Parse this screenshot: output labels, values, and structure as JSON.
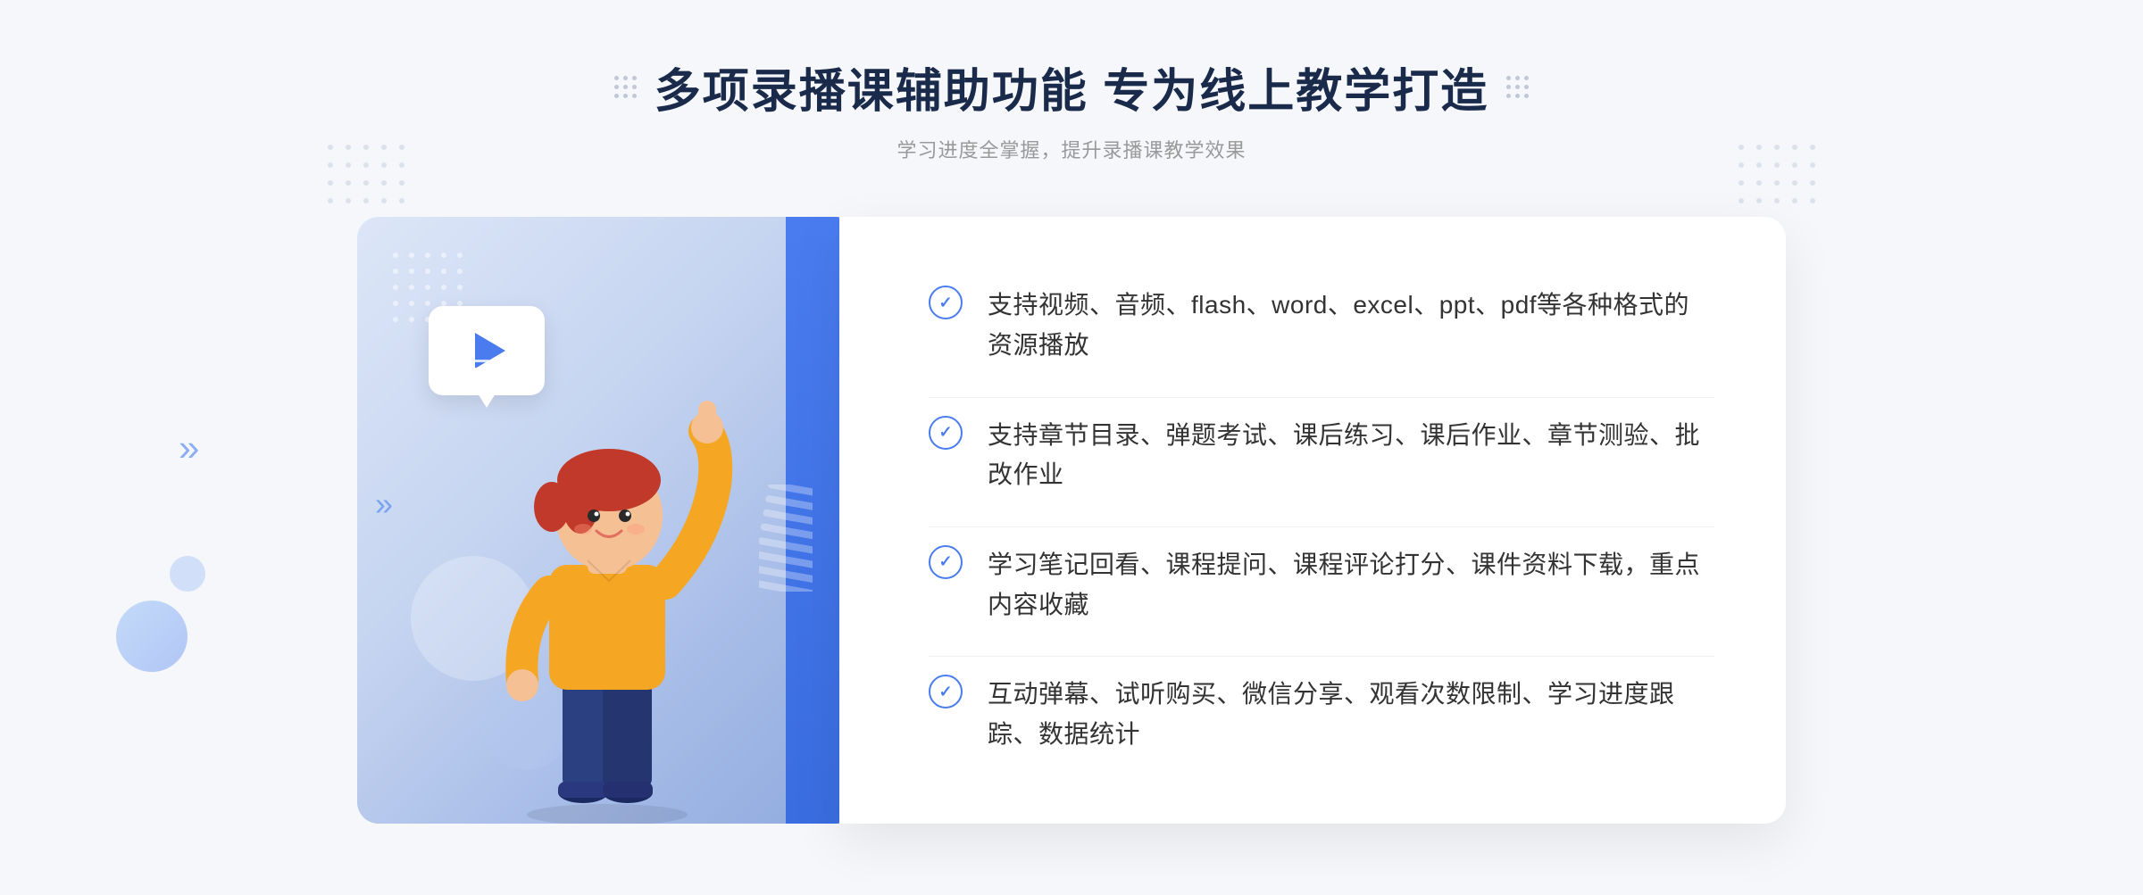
{
  "header": {
    "title": "多项录播课辅助功能 专为线上教学打造",
    "subtitle": "学习进度全掌握，提升录播课教学效果"
  },
  "features": [
    {
      "id": "feature-1",
      "text": "支持视频、音频、flash、word、excel、ppt、pdf等各种格式的资源播放"
    },
    {
      "id": "feature-2",
      "text": "支持章节目录、弹题考试、课后练习、课后作业、章节测验、批改作业"
    },
    {
      "id": "feature-3",
      "text": "学习笔记回看、课程提问、课程评论打分、课件资料下载，重点内容收藏"
    },
    {
      "id": "feature-4",
      "text": "互动弹幕、试听购买、微信分享、观看次数限制、学习进度跟踪、数据统计"
    }
  ],
  "decorations": {
    "chevron_left": "»",
    "chevron_right": "«"
  }
}
